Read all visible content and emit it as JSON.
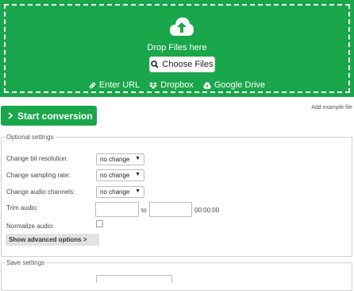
{
  "upload": {
    "drop_text": "Drop Files here",
    "choose_label": "Choose Files",
    "sources": [
      {
        "label": "Enter URL",
        "icon": "link-icon"
      },
      {
        "label": "Dropbox",
        "icon": "dropbox-icon"
      },
      {
        "label": "Google Drive",
        "icon": "google-drive-icon"
      }
    ],
    "icon": "cloud-upload-icon"
  },
  "actions": {
    "start_label": "Start conversion",
    "example_label": "Add example file"
  },
  "optional": {
    "legend": "Optional settings",
    "bit_resolution": {
      "label": "Change bit resolution:",
      "value": "no change"
    },
    "sampling_rate": {
      "label": "Change sampling rate:",
      "value": "no change"
    },
    "audio_channels": {
      "label": "Change audio channels:",
      "value": "no change"
    },
    "trim": {
      "label": "Trim audio:",
      "to": "to",
      "duration": "00:00:00"
    },
    "normalize": {
      "label": "Normalize audio:"
    },
    "advanced_label": "Show advanced options >"
  },
  "save": {
    "legend": "Save settings"
  },
  "colors": {
    "accent": "#1aa64a"
  }
}
